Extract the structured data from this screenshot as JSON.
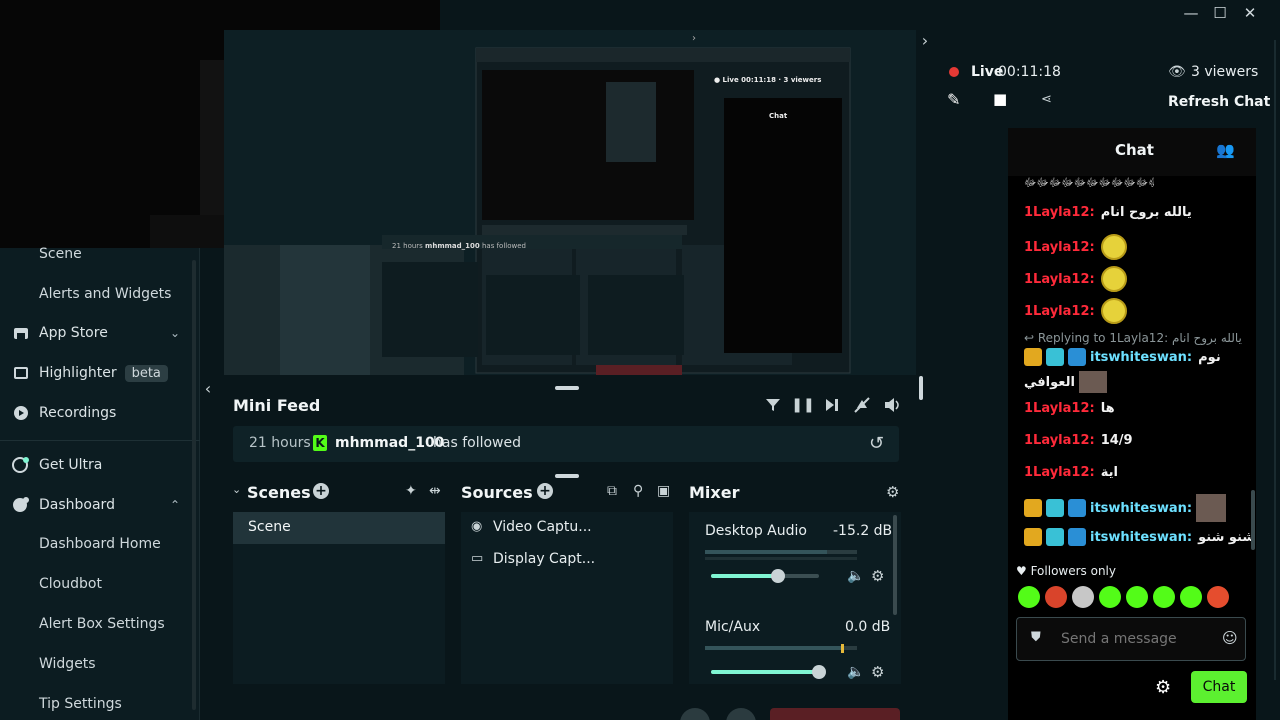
{
  "window": {
    "minimize": "—",
    "maximize": "☐",
    "close": "✕"
  },
  "sidebar": {
    "items": [
      {
        "label": "Scene",
        "type": "sub"
      },
      {
        "label": "Alerts and Widgets",
        "type": "sub"
      },
      {
        "label": "App Store",
        "icon": "store-icon",
        "chevron": "⌄"
      },
      {
        "label": "Highlighter",
        "icon": "highlighter-icon",
        "badge": "beta"
      },
      {
        "label": "Recordings",
        "icon": "play-icon"
      },
      {
        "label": "Get Ultra",
        "icon": "ultra-icon"
      },
      {
        "label": "Dashboard",
        "icon": "dashboard-icon",
        "chevron": "⌃"
      },
      {
        "label": "Dashboard Home",
        "type": "sub"
      },
      {
        "label": "Cloudbot",
        "type": "sub"
      },
      {
        "label": "Alert Box Settings",
        "type": "sub"
      },
      {
        "label": "Widgets",
        "type": "sub"
      },
      {
        "label": "Tip Settings",
        "type": "sub"
      }
    ]
  },
  "mini_feed": {
    "title": "Mini Feed",
    "event": {
      "time": "21 hours",
      "user": "mhmmad_100",
      "action": "has followed"
    }
  },
  "scenes": {
    "title": "Scenes",
    "items": [
      "Scene"
    ]
  },
  "sources": {
    "title": "Sources",
    "items": [
      "Video Captu...",
      "Display Capt..."
    ]
  },
  "mixer": {
    "title": "Mixer",
    "channels": [
      {
        "name": "Desktop Audio",
        "level": "-15.2 dB",
        "volume": 0.62
      },
      {
        "name": "Mic/Aux",
        "level": "0.0 dB",
        "volume": 1.0
      }
    ]
  },
  "stream": {
    "live_label": "Live",
    "time": "00:11:18",
    "viewers": "3 viewers",
    "refresh": "Refresh Chat"
  },
  "chat": {
    "title": "Chat",
    "top_line": "ﷻﷻﷻﷻﷻﷻﷻﷻﷻﷻﷻﷻ",
    "messages": [
      {
        "user": "1Layla12:",
        "text": "يالله بروح انام"
      },
      {
        "user": "1Layla12:",
        "text": ""
      },
      {
        "user": "1Layla12:",
        "text": ""
      },
      {
        "user": "1Layla12:",
        "text": ""
      },
      {
        "reply": "Replying to 1Layla12: يالله بروح انام"
      },
      {
        "user": "itswhiteswan:",
        "text": "نوم",
        "cont": "العوافي"
      },
      {
        "user": "1Layla12:",
        "text": "ها"
      },
      {
        "user": "1Layla12:",
        "text": "14/9"
      },
      {
        "user": "1Layla12:",
        "text": "اية"
      },
      {
        "user": "itswhiteswan:",
        "text": ""
      },
      {
        "user": "itswhiteswan:",
        "text": "شنو شنو"
      }
    ],
    "followers_only": "Followers only",
    "input_placeholder": "Send a message",
    "send_label": "Chat"
  },
  "colors": {
    "accent": "#80f5d2",
    "chat_button": "#5cf030",
    "live": "#e53935",
    "layla": "#ff2a3a",
    "itswhiteswan": "#6de0ff"
  }
}
